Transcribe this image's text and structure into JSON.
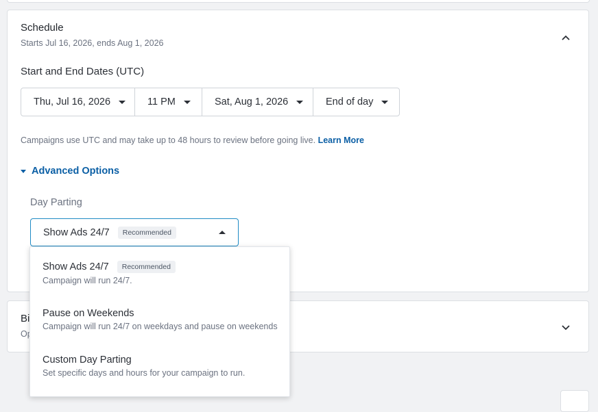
{
  "schedule": {
    "title": "Schedule",
    "subtitle": "Starts Jul 16, 2026, ends Aug 1, 2026",
    "dates_label": "Start and End Dates (UTC)",
    "start_date": "Thu, Jul 16, 2026",
    "start_time": "11 PM",
    "end_date": "Sat, Aug 1, 2026",
    "end_time": "End of day",
    "note": "Campaigns use UTC and may take up to 48 hours to review before going live.",
    "learn_more": "Learn More",
    "advanced_options": "Advanced Options",
    "day_parting_label": "Day Parting",
    "day_parting_value": "Show Ads 24/7",
    "day_parting_badge": "Recommended"
  },
  "dropdown": {
    "options": [
      {
        "title": "Show Ads 24/7",
        "badge": "Recommended",
        "desc": "Campaign will run 24/7."
      },
      {
        "title": "Pause on Weekends",
        "desc": "Campaign will run 24/7 on weekdays and pause on weekends"
      },
      {
        "title": "Custom Day Parting",
        "desc": "Set specific days and hours for your campaign to run."
      }
    ]
  },
  "budget": {
    "title_partial": "Bi",
    "subtitle_partial": "Op"
  },
  "colors": {
    "link": "#0b5fa5",
    "focus_border": "#1d8ac4"
  }
}
